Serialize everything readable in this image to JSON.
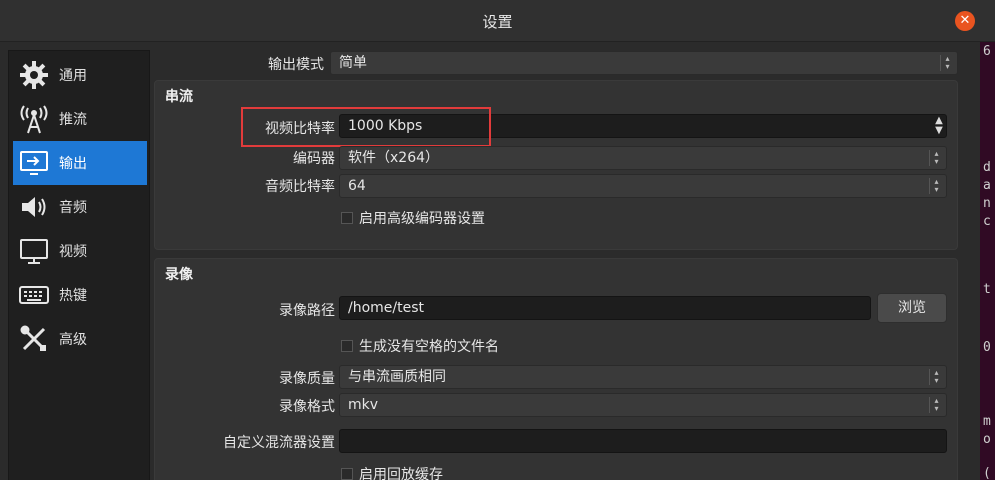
{
  "window": {
    "title": "设置",
    "close_icon": "close-icon"
  },
  "terminal": {
    "chars": [
      "6",
      "d",
      "a",
      "n",
      "c",
      "t",
      "0",
      "m",
      "o",
      "("
    ]
  },
  "sidebar": {
    "items": [
      {
        "label": "通用",
        "icon": "gear-icon",
        "active": false
      },
      {
        "label": "推流",
        "icon": "antenna-icon",
        "active": false
      },
      {
        "label": "输出",
        "icon": "output-icon",
        "active": true
      },
      {
        "label": "音频",
        "icon": "speaker-icon",
        "active": false
      },
      {
        "label": "视频",
        "icon": "monitor-icon",
        "active": false
      },
      {
        "label": "热键",
        "icon": "keyboard-icon",
        "active": false
      },
      {
        "label": "高级",
        "icon": "tools-icon",
        "active": false
      }
    ]
  },
  "output_mode": {
    "label": "输出模式",
    "value": "简单"
  },
  "streaming": {
    "title": "串流",
    "video_bitrate": {
      "label": "视频比特率",
      "value": "1000 Kbps"
    },
    "encoder": {
      "label": "编码器",
      "value": "软件（x264）"
    },
    "audio_bitrate": {
      "label": "音频比特率",
      "value": "64"
    },
    "advanced_encoder": {
      "label": "启用高级编码器设置",
      "checked": false
    }
  },
  "recording": {
    "title": "录像",
    "path": {
      "label": "录像路径",
      "value": "/home/test",
      "browse": "浏览"
    },
    "no_space_filename": {
      "label": "生成没有空格的文件名",
      "checked": false
    },
    "quality": {
      "label": "录像质量",
      "value": "与串流画质相同"
    },
    "format": {
      "label": "录像格式",
      "value": "mkv"
    },
    "muxer": {
      "label": "自定义混流器设置",
      "value": ""
    },
    "replay_buffer": {
      "label": "启用回放缓存",
      "checked": false
    }
  },
  "colors": {
    "accent": "#1e78d5",
    "highlight": "#e23b3b",
    "close": "#e95420"
  }
}
